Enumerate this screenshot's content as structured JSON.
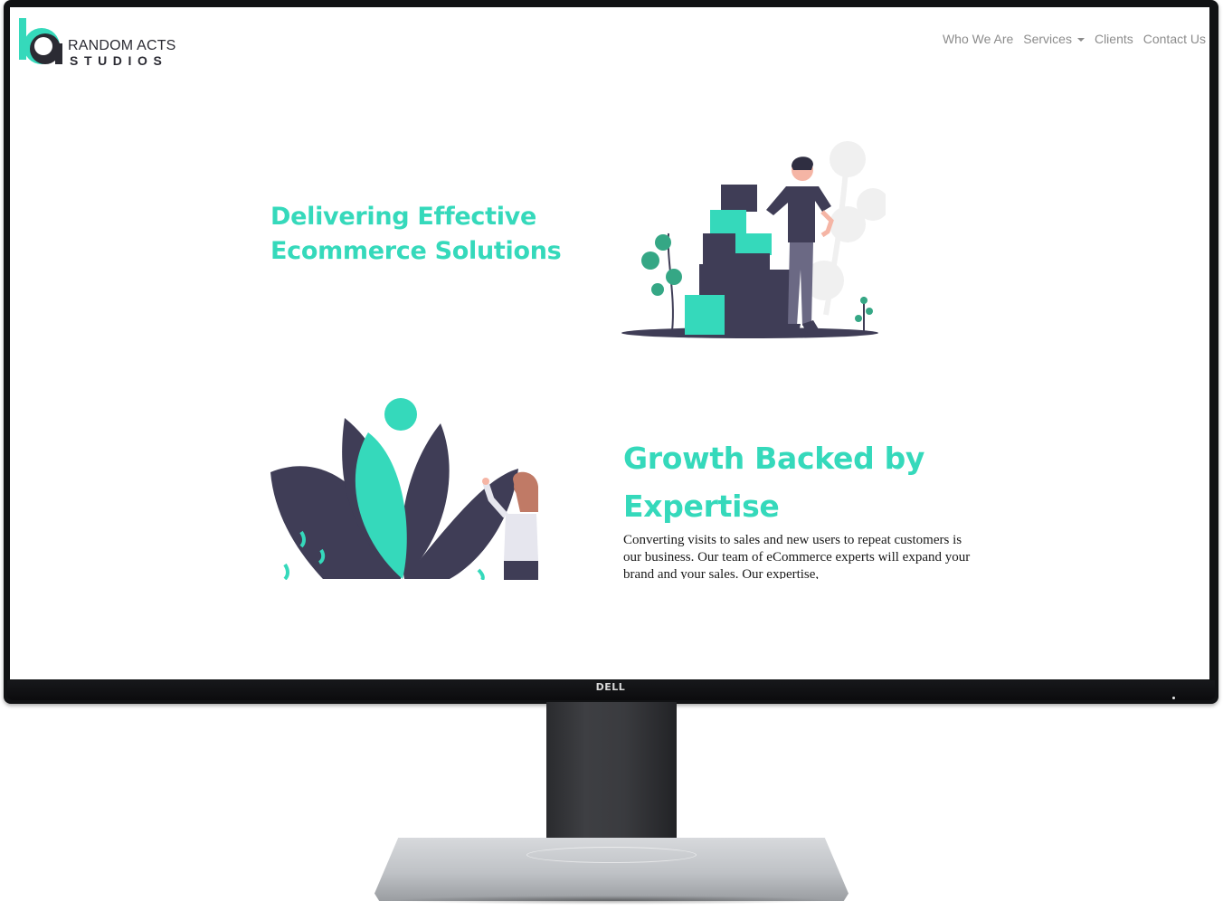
{
  "logo": {
    "line1": "RANDOM ACTS",
    "line2": "STUDIOS",
    "accent_color": "#35d9bb"
  },
  "nav": {
    "items": [
      {
        "label": "Who We Are"
      },
      {
        "label": "Services"
      },
      {
        "label": "Clients"
      },
      {
        "label": "Contact Us"
      }
    ]
  },
  "hero": {
    "title": "Delivering Effective Ecommerce Solutions",
    "illustration_icon": "person-with-boxes-illustration"
  },
  "growth": {
    "title": "Growth Backed by Expertise",
    "body": "Converting visits to sales and new users to repeat customers is our business. Our team of eCommerce experts will expand your brand and your sales. Our expertise,",
    "illustration_icon": "woman-with-leaves-illustration"
  },
  "monitor": {
    "brand": "DELL"
  },
  "colors": {
    "accent": "#35d9bb",
    "dark": "#3f3d56",
    "nav_text": "#8c8c8c"
  }
}
